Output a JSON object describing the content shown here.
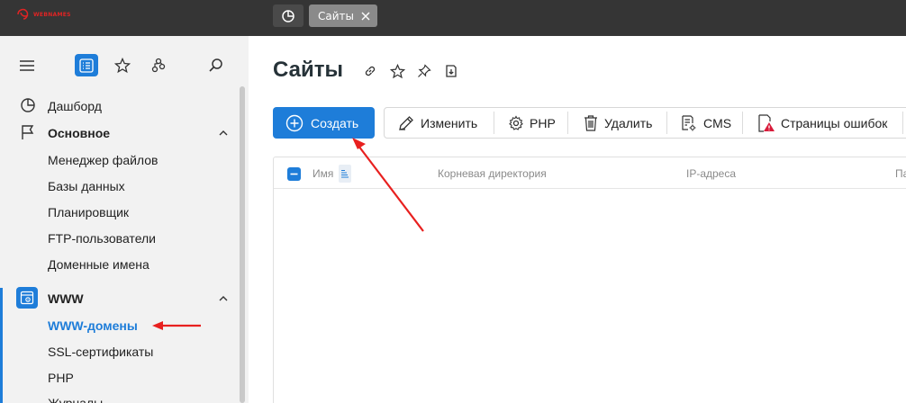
{
  "brand": {
    "logo_text": "WEBNAMES"
  },
  "tabs": [
    {
      "icon": "dashboard-icon"
    },
    {
      "label": "Сайты",
      "close_icon": "close-icon"
    }
  ],
  "sidebar": {
    "tools": [
      "menu-icon",
      "list-icon",
      "star-icon",
      "branch-icon",
      "search-icon"
    ],
    "items": [
      {
        "label": "Дашборд",
        "icon": "dashboard-icon"
      },
      {
        "label": "Основное",
        "icon": "flag-icon",
        "group": true
      },
      {
        "label": "Менеджер файлов"
      },
      {
        "label": "Базы данных"
      },
      {
        "label": "Планировщик"
      },
      {
        "label": "FTP-пользователи"
      },
      {
        "label": "Доменные имена"
      },
      {
        "label": "WWW",
        "icon": "www-icon",
        "group": true
      },
      {
        "label": "WWW-домены",
        "active": true
      },
      {
        "label": "SSL-сертификаты"
      },
      {
        "label": "PHP"
      },
      {
        "label": "Журналы"
      }
    ]
  },
  "main": {
    "title": "Сайты",
    "title_icons": [
      "link-icon",
      "star-icon",
      "pin-icon",
      "download-icon"
    ],
    "create_label": "Создать",
    "toolbar": [
      "Изменить",
      "PHP",
      "Удалить",
      "CMS",
      "Страницы ошибок"
    ],
    "columns": [
      "Имя",
      "Корневая директория",
      "IP-адреса",
      "Па"
    ]
  },
  "colors": {
    "accent": "#1e7dd9",
    "topbar": "#353535",
    "annotation": "#e8201f"
  }
}
